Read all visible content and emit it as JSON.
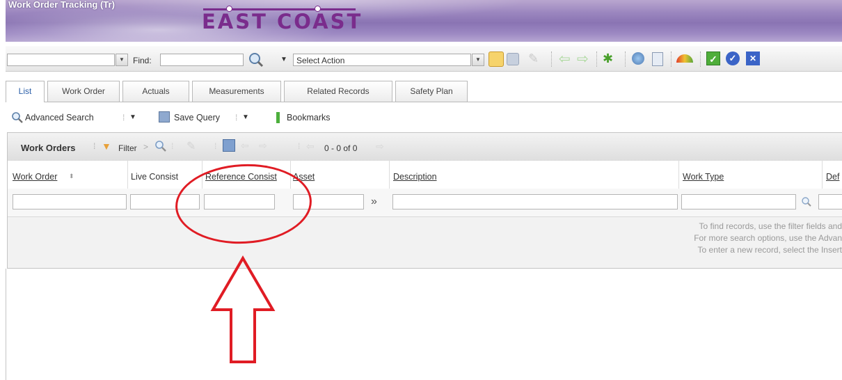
{
  "app": {
    "title": "Work Order Tracking (Tr)",
    "logo_text": "EAST COAST"
  },
  "toolbar": {
    "find_label": "Find:",
    "action_select": "Select Action",
    "icons": [
      "new-record-icon",
      "save-icon",
      "clear-icon",
      "previous-icon",
      "next-icon",
      "workflow-icon",
      "view-icon",
      "report-icon",
      "gauge-icon",
      "approve-icon",
      "check-icon",
      "close-icon"
    ]
  },
  "tabs": [
    {
      "label": "List",
      "active": true
    },
    {
      "label": "Work Order"
    },
    {
      "label": "Actuals"
    },
    {
      "label": "Measurements"
    },
    {
      "label": "Related Records"
    },
    {
      "label": "Safety Plan"
    }
  ],
  "search": {
    "advanced_label": "Advanced Search",
    "save_query_label": "Save Query",
    "bookmarks_label": "Bookmarks"
  },
  "grid": {
    "title": "Work Orders",
    "filter_label": "Filter",
    "count": "0 - 0 of 0",
    "columns": [
      "Work Order",
      "Live Consist",
      "Reference Consist",
      "Asset",
      "Description",
      "Work Type",
      "Def"
    ],
    "messages": [
      "To find records, use the filter fields and",
      "For more search options, use the Advan",
      "To enter a new record, select the Insert"
    ]
  },
  "colors": {
    "banner": "#9b86bf",
    "logo": "#7a2c8c",
    "annotation": "#e01c24",
    "active_tab_text": "#2a5ea8"
  }
}
